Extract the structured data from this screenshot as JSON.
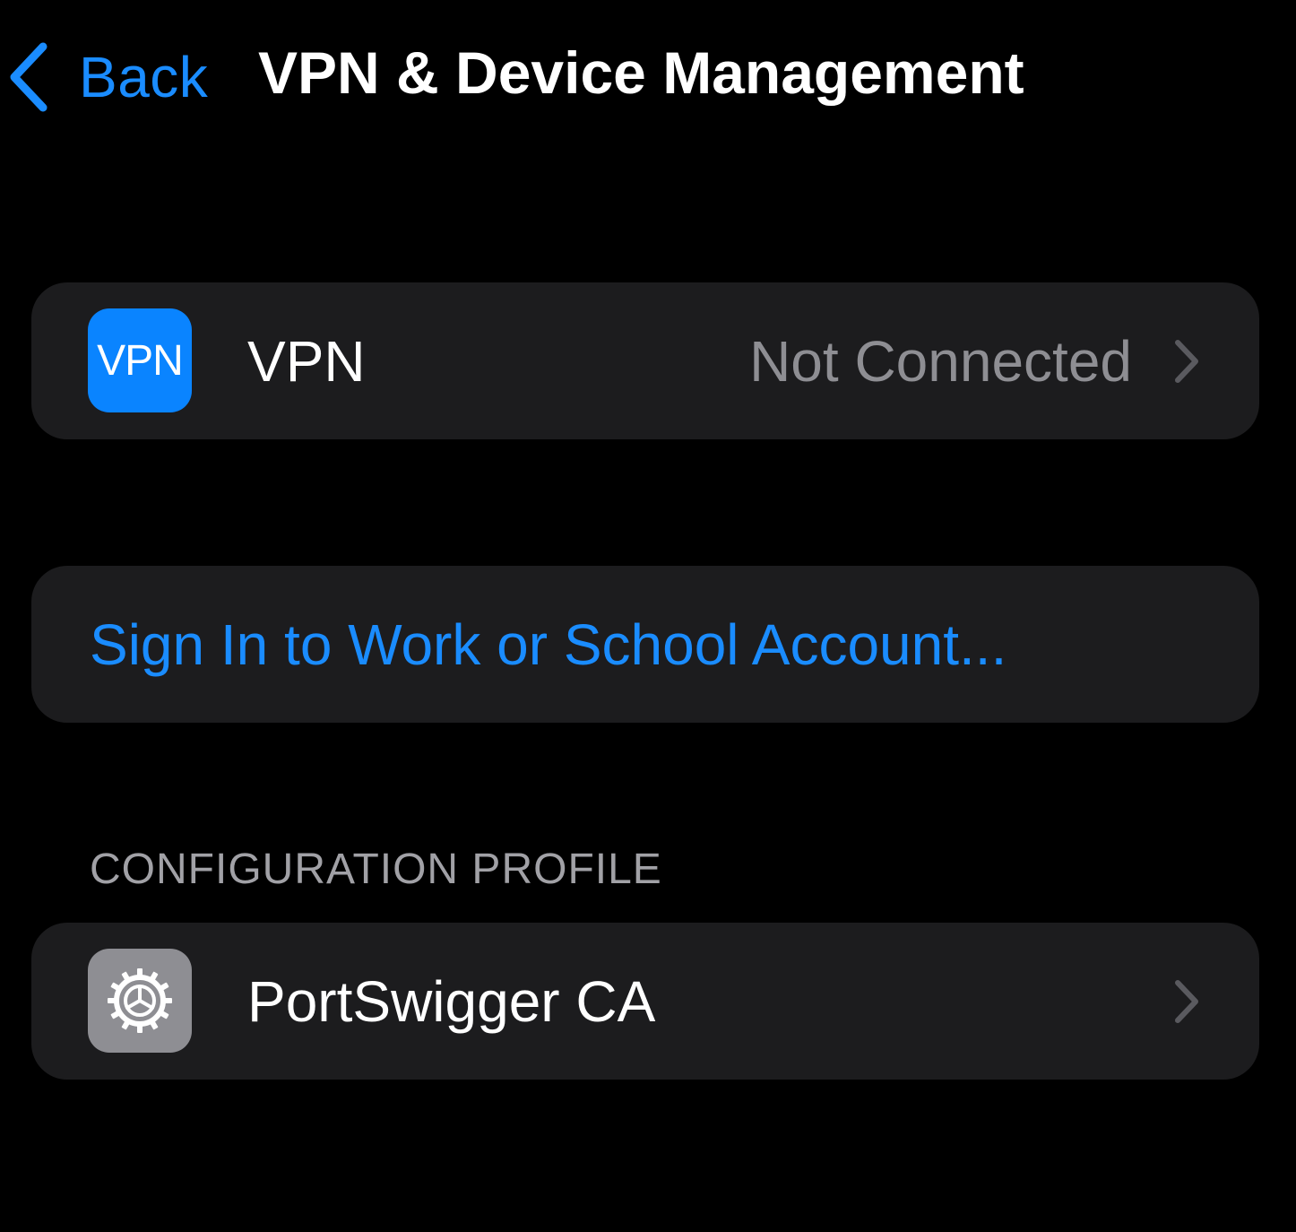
{
  "nav": {
    "back_label": "Back",
    "title": "VPN & Device Management"
  },
  "vpn_row": {
    "icon": "vpn-icon",
    "icon_text": "VPN",
    "label": "VPN",
    "value": "Not Connected"
  },
  "account_row": {
    "label": "Sign In to Work or School Account..."
  },
  "configuration_section": {
    "header": "CONFIGURATION PROFILE",
    "items": [
      {
        "icon": "settings-gear-icon",
        "label": "PortSwigger CA"
      }
    ]
  },
  "colors": {
    "background": "#000000",
    "group_background": "#1c1c1e",
    "accent_blue": "#1a8cff",
    "vpn_icon_blue": "#0a84ff",
    "secondary_text": "#8e8e93",
    "settings_icon_gray": "#8e8e93"
  }
}
